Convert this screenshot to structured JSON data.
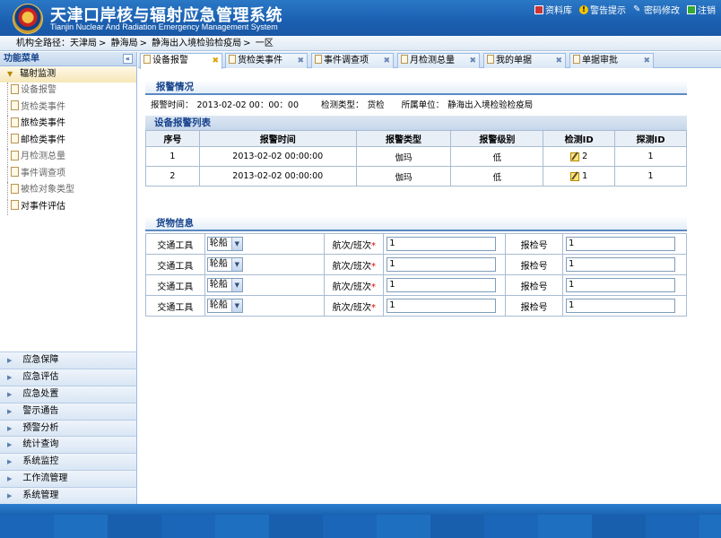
{
  "header": {
    "title": "天津口岸核与辐射应急管理系统",
    "subtitle": "Tianjin Nuclear And Radiation Emergency Management System",
    "links": [
      "资料库",
      "警告提示",
      "密码修改",
      "注销"
    ]
  },
  "breadcrumb": [
    "机构全路径：天津局",
    ">",
    "静海局",
    ">",
    "静海出入境检验检疫局",
    ">",
    "一区"
  ],
  "sidebar": {
    "title": "功能菜单",
    "section": "辐射监测",
    "items": [
      "设备报警",
      "货检类事件",
      "旅检类事件",
      "邮检类事件",
      "月检测总量",
      "事件调查项",
      "被检对象类型",
      "对事件评估"
    ],
    "menus": [
      "应急保障",
      "应急评估",
      "应急处置",
      "警示通告",
      "预警分析",
      "统计查询",
      "系统监控",
      "工作流管理",
      "系统管理"
    ]
  },
  "tabs": [
    "设备报警",
    "货检类事件",
    "事件调查项",
    "月检测总量",
    "我的单据",
    "单据审批"
  ],
  "alarm": {
    "section_title": "报警情况",
    "time_label": "报警时间：",
    "time_value": "2013-02-02  00：00：00",
    "type_label": "检测类型：",
    "type_value": "货检",
    "unit_label": "所属单位：",
    "unit_value": "静海出入境检验检疫局"
  },
  "alarm_list": {
    "title": "设备报警列表",
    "headers": [
      "序号",
      "报警时间",
      "报警类型",
      "报警级别",
      "检测ID",
      "探测ID"
    ],
    "rows": [
      [
        "1",
        "2013-02-02 00:00:00",
        "伽玛",
        "低",
        "2",
        "1"
      ],
      [
        "2",
        "2013-02-02 00:00:00",
        "伽玛",
        "低",
        "1",
        "1"
      ]
    ]
  },
  "cargo": {
    "section_title": "货物信息",
    "transport_label": "交通工具",
    "flight_label": "航次/班次",
    "required_mark": "*",
    "inspection_label": "报检号",
    "rows": [
      {
        "transport": "轮船",
        "flight": "1",
        "inspection": "1"
      },
      {
        "transport": "轮船",
        "flight": "1",
        "inspection": "1"
      },
      {
        "transport": "轮船",
        "flight": "1",
        "inspection": "1"
      },
      {
        "transport": "轮船",
        "flight": "1",
        "inspection": "1"
      }
    ]
  },
  "icons": {
    "collapse": "«",
    "section_arrow": "▼",
    "menu_arrow": "▶",
    "tab_close": "✖",
    "select_arrow": "▼",
    "warn": "!",
    "pen": "✎"
  }
}
